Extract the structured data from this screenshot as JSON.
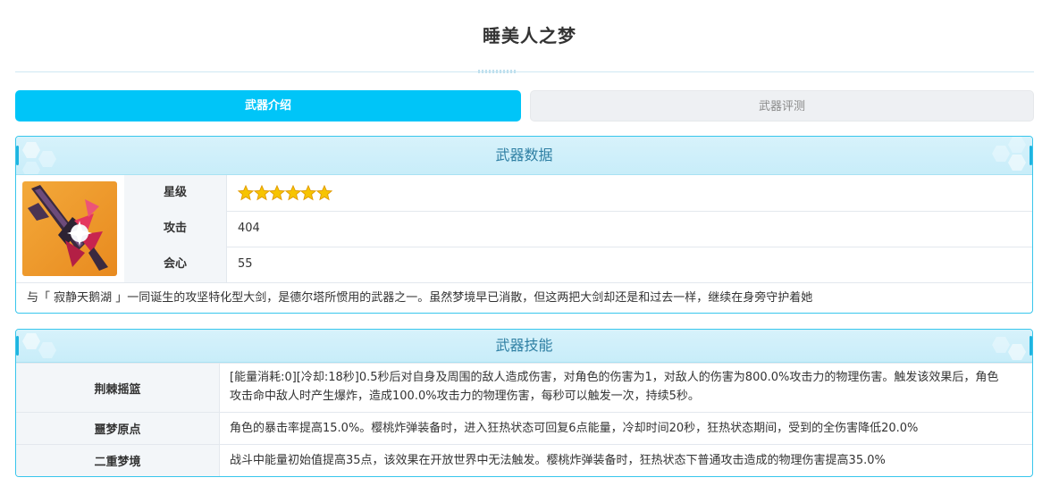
{
  "page": {
    "title": "睡美人之梦"
  },
  "tabs": [
    {
      "label": "武器介绍",
      "active": true
    },
    {
      "label": "武器评测",
      "active": false
    }
  ],
  "weapon_data": {
    "header": "武器数据",
    "icon": "weapon-greatsword-icon",
    "rows": [
      {
        "key": "星级",
        "stars": 6
      },
      {
        "key": "攻击",
        "value": "404"
      },
      {
        "key": "会心",
        "value": "55"
      }
    ],
    "description": "与「 寂静天鹅湖 」一同诞生的攻坚特化型大剑，是德尔塔所惯用的武器之一。虽然梦境早已消散，但这两把大剑却还是和过去一样，继续在身旁守护着她"
  },
  "weapon_skills": {
    "header": "武器技能",
    "skills": [
      {
        "name": "荆棘摇篮",
        "desc": "[能量消耗:0][冷却:18秒]0.5秒后对自身及周围的敌人造成伤害，对角色的伤害为1，对敌人的伤害为800.0%攻击力的物理伤害。触发该效果后，角色攻击命中敌人时产生爆炸，造成100.0%攻击力的物理伤害，每秒可以触发一次，持续5秒。"
      },
      {
        "name": "噩梦原点",
        "desc": "角色的暴击率提高15.0%。樱桃炸弹装备时，进入狂热状态可回复6点能量，冷却时间20秒，狂热状态期间，受到的全伤害降低20.0%"
      },
      {
        "name": "二重梦境",
        "desc": "战斗中能量初始值提高35点，该效果在开放世界中无法触发。樱桃炸弹装备时，狂热状态下普通攻击造成的物理伤害提高35.0%"
      }
    ]
  },
  "colors": {
    "accent": "#00c5f8",
    "border": "#38c6ec",
    "header_bg": "#c8edf9",
    "star": "#f7c400"
  }
}
